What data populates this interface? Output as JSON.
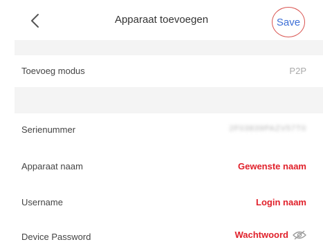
{
  "header": {
    "title": "Apparaat toevoegen",
    "save_label": "Save",
    "back_icon": "chevron-left-icon"
  },
  "rows": [
    {
      "label": "Toevoeg modus",
      "value": "P2P"
    },
    {
      "label": "Serienummer",
      "value": "2F03839PAZV57T0"
    },
    {
      "label": "Apparaat naam",
      "value": "Gewenste naam"
    },
    {
      "label": "Username",
      "value": "Login naam"
    },
    {
      "label": "Device Password",
      "value": "Wachtwoord",
      "icon": "eye-slash-icon"
    }
  ],
  "colors": {
    "accent_red": "#e0202a",
    "save_blue": "#3d6fd6",
    "circle_red": "#d9534f",
    "section_gap": "#f4f4f4"
  }
}
